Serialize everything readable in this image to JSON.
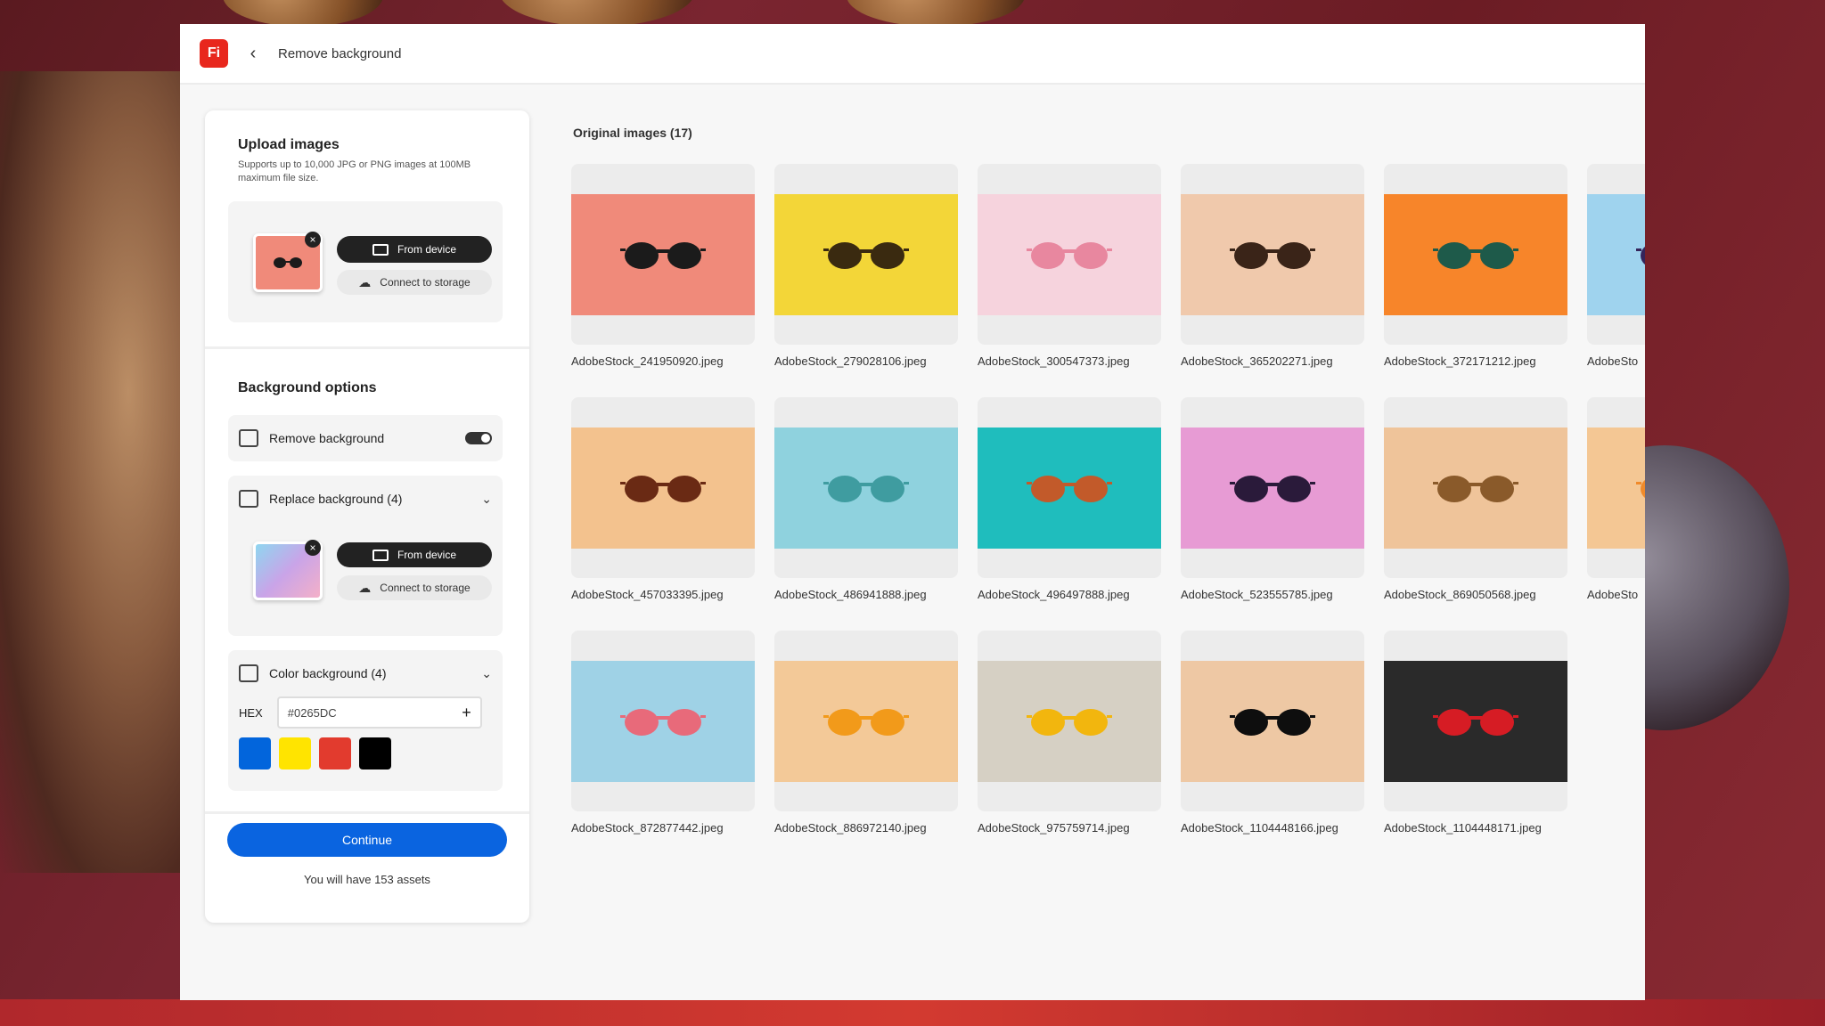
{
  "app": {
    "logo_text": "Fi",
    "breadcrumb": "Remove background",
    "accent": "#0A64E0"
  },
  "upload": {
    "title": "Upload images",
    "subtitle": "Supports up to 10,000 JPG or PNG images at 100MB maximum file size.",
    "from_device": "From device",
    "connect_storage": "Connect to storage"
  },
  "background_options": {
    "title": "Background options",
    "remove_label": "Remove background",
    "remove_enabled": true,
    "replace_label": "Replace background (4)",
    "replace_from_device": "From device",
    "replace_connect_storage": "Connect to storage",
    "color_label": "Color background (4)",
    "hex_label": "HEX",
    "hex_value": "#0265DC",
    "swatches": [
      "#0265DC",
      "#FFE400",
      "#E23B2E",
      "#000000"
    ]
  },
  "footer": {
    "continue_label": "Continue",
    "assets_text": "You will have 153 assets"
  },
  "gallery": {
    "title": "Original images (17)",
    "images": [
      {
        "name": "AdobeStock_241950920.jpeg",
        "bg": "#f08a7a",
        "glasses": "#1b1b1b"
      },
      {
        "name": "AdobeStock_279028106.jpeg",
        "bg": "#f3d638",
        "glasses": "#3a2a10"
      },
      {
        "name": "AdobeStock_300547373.jpeg",
        "bg": "#f6d3dd",
        "glasses": "#e8879f"
      },
      {
        "name": "AdobeStock_365202271.jpeg",
        "bg": "#f0c9ac",
        "glasses": "#3a2418"
      },
      {
        "name": "AdobeStock_372171212.jpeg",
        "bg": "#f7852a",
        "glasses": "#1e5a4a"
      },
      {
        "name": "AdobeSto",
        "bg": "#9fd3ee",
        "glasses": "#35245a"
      },
      {
        "name": "AdobeStock_457033395.jpeg",
        "bg": "#f3c28e",
        "glasses": "#6a2a14"
      },
      {
        "name": "AdobeStock_486941888.jpeg",
        "bg": "#8fd2de",
        "glasses": "#3f9ca0"
      },
      {
        "name": "AdobeStock_496497888.jpeg",
        "bg": "#1fbdbd",
        "glasses": "#c25a2a"
      },
      {
        "name": "AdobeStock_523555785.jpeg",
        "bg": "#e79bd4",
        "glasses": "#2a1a3a"
      },
      {
        "name": "AdobeStock_869050568.jpeg",
        "bg": "#efc49a",
        "glasses": "#8a5a2a"
      },
      {
        "name": "AdobeSto",
        "bg": "#f4c794",
        "glasses": "#f08a2a"
      },
      {
        "name": "AdobeStock_872877442.jpeg",
        "bg": "#9fd2e6",
        "glasses": "#e86a7a"
      },
      {
        "name": "AdobeStock_886972140.jpeg",
        "bg": "#f3c998",
        "glasses": "#f29a1a"
      },
      {
        "name": "AdobeStock_975759714.jpeg",
        "bg": "#d6d0c4",
        "glasses": "#f2b60e"
      },
      {
        "name": "AdobeStock_1104448166.jpeg",
        "bg": "#eec8a4",
        "glasses": "#0e0e0e"
      },
      {
        "name": "AdobeStock_1104448171.jpeg",
        "bg": "#2a2a2a",
        "glasses": "#d61c24"
      }
    ]
  }
}
